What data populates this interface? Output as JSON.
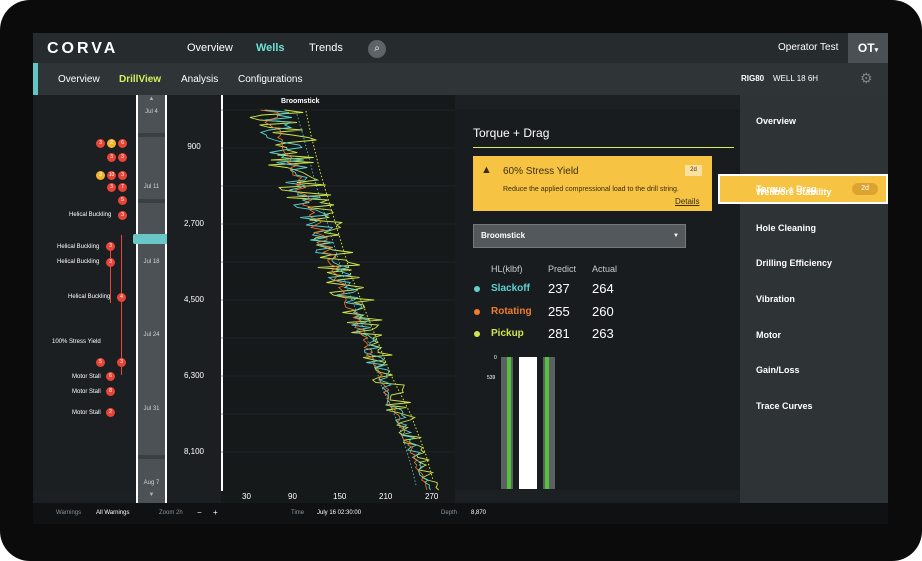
{
  "top_nav": {
    "logo": "CORVA",
    "items": [
      "Overview",
      "Wells",
      "Trends"
    ],
    "active": "Wells",
    "user": "Operator Test",
    "user_initials": "OT"
  },
  "sub_nav": {
    "items": [
      "Overview",
      "DrillView",
      "Analysis",
      "Configurations"
    ],
    "active": "DrillView",
    "rig": "RIG80",
    "well": "WELL 18 6H"
  },
  "events": [
    {
      "label": "",
      "markers": [
        "3",
        "2",
        "6"
      ]
    },
    {
      "label": "",
      "markers": [
        "3",
        "3"
      ]
    },
    {
      "label": "",
      "markers": [
        "3",
        "10",
        "3"
      ]
    },
    {
      "label": "",
      "markers": [
        "3",
        "7"
      ]
    },
    {
      "label": "",
      "markers": [
        "5"
      ]
    },
    {
      "label": "Helical Buckling",
      "markers": [
        "3"
      ]
    },
    {
      "label": "Helical Buckling",
      "markers": [
        "3"
      ]
    },
    {
      "label": "Helical Buckling",
      "markers": [
        "3"
      ]
    },
    {
      "label": "Helical Buckling",
      "markers": [
        "4"
      ]
    },
    {
      "label": "100% Stress Yield",
      "markers": []
    },
    {
      "label": "",
      "markers": [
        "5",
        "3"
      ]
    },
    {
      "label": "Motor Stall",
      "markers": [
        "6"
      ]
    },
    {
      "label": "Motor Stall",
      "markers": [
        "8"
      ]
    },
    {
      "label": "Motor Stall",
      "markers": [
        "2"
      ]
    }
  ],
  "timeline": {
    "dates": [
      "Jul 4",
      "Jul 11",
      "Jul 18",
      "Jul 24",
      "Jul 31",
      "Aug 7"
    ]
  },
  "depth_axis": {
    "labels": [
      "900",
      "2,700",
      "4,500",
      "6,300",
      "8,100"
    ]
  },
  "plot": {
    "title": "Broomstick",
    "x_ticks": [
      "30",
      "90",
      "150",
      "210",
      "270"
    ]
  },
  "torque_drag": {
    "title": "Torque + Drag",
    "alert": {
      "title": "60% Stress Yield",
      "badge": "2d",
      "description": "Reduce the applied compressional load to the drill string.",
      "link": "Details"
    },
    "select": "Broomstick",
    "table": {
      "headers": [
        "HL(klbf)",
        "Predict",
        "Actual"
      ],
      "rows": [
        {
          "label": "Slackoff",
          "predict": "237",
          "actual": "264",
          "color": "#5ed1d1"
        },
        {
          "label": "Rotating",
          "predict": "255",
          "actual": "260",
          "color": "#f07d2e"
        },
        {
          "label": "Pickup",
          "predict": "281",
          "actual": "263",
          "color": "#cfe64a"
        }
      ]
    },
    "wellbore_labels": [
      "0",
      "539"
    ]
  },
  "right_nav": {
    "items": [
      "Overview",
      "Torque + Drag",
      "Wellbore Stability",
      "Hole Cleaning",
      "Drilling Efficiency",
      "Vibration",
      "Motor",
      "Gain/Loss",
      "Trace Curves"
    ],
    "active": "Torque + Drag",
    "active_badge": "2d"
  },
  "bottom_bar": {
    "warnings_label": "Warnings",
    "warnings_value": "All Warnings",
    "zoom_label": "Zoom 2h",
    "zoom_minus": "−",
    "zoom_plus": "+",
    "time_label": "Time",
    "time_value": "July 16 02:30:00",
    "depth_label": "Depth",
    "depth_value": "8,870"
  }
}
